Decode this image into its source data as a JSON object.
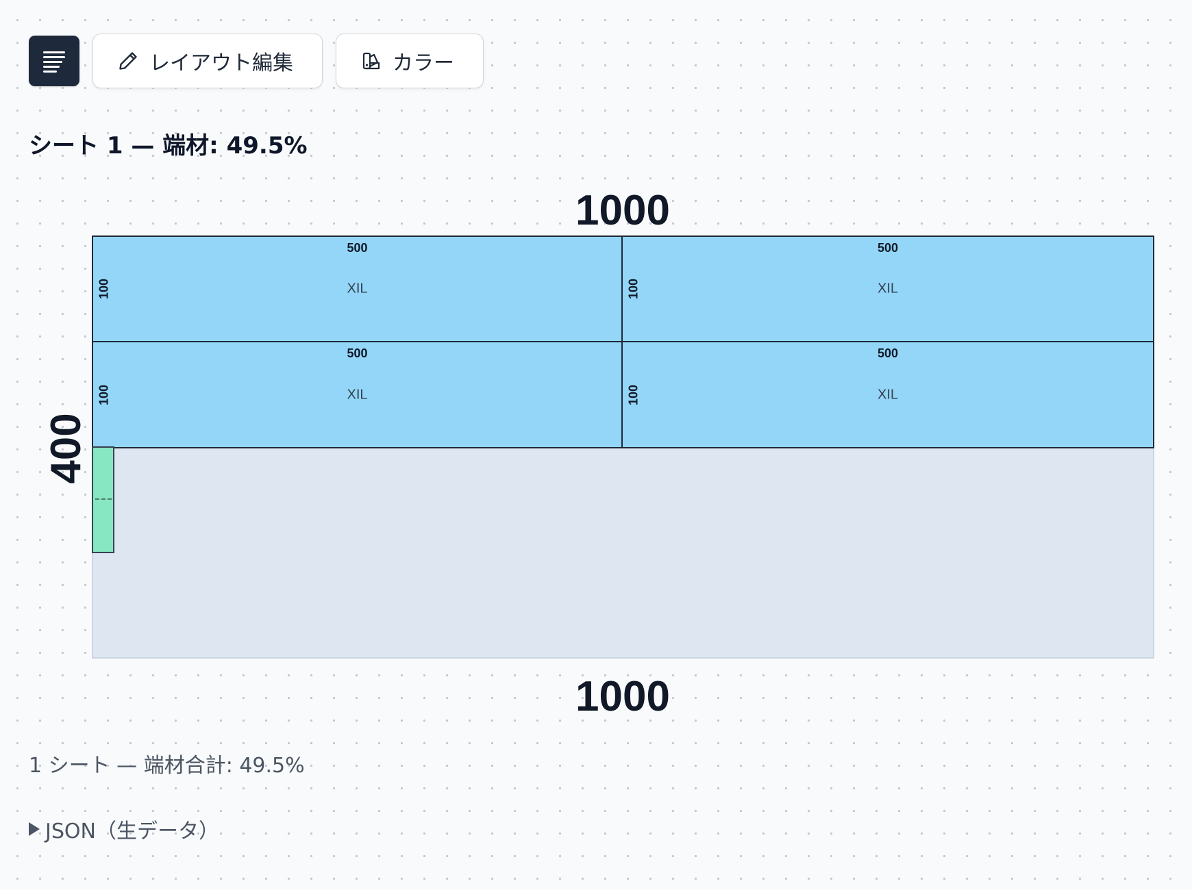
{
  "toolbar": {
    "menu_icon": "menu-lines-icon",
    "layout_edit_icon": "pencil-icon",
    "layout_edit_label": "レイアウト編集",
    "color_icon": "palette-icon",
    "color_label": "カラー"
  },
  "sheet": {
    "title": "シート 1 — 端材: 49.5%",
    "width_label_top": "1000",
    "width_label_bottom": "1000",
    "height_label": "400",
    "background_color": "#dee6f1",
    "pieces": [
      {
        "width_label": "500",
        "height_label": "100",
        "name": "XIL",
        "color": "#93d6f8"
      },
      {
        "width_label": "500",
        "height_label": "100",
        "name": "XIL",
        "color": "#93d6f8"
      },
      {
        "width_label": "500",
        "height_label": "100",
        "name": "XIL",
        "color": "#93d6f8"
      },
      {
        "width_label": "500",
        "height_label": "100",
        "name": "XIL",
        "color": "#93d6f8"
      }
    ],
    "extra_piece_color": "#86e7c2"
  },
  "summary": {
    "total_label": "1 シート — 端材合計: 49.5%"
  },
  "json_section": {
    "label": "JSON（生データ）"
  }
}
